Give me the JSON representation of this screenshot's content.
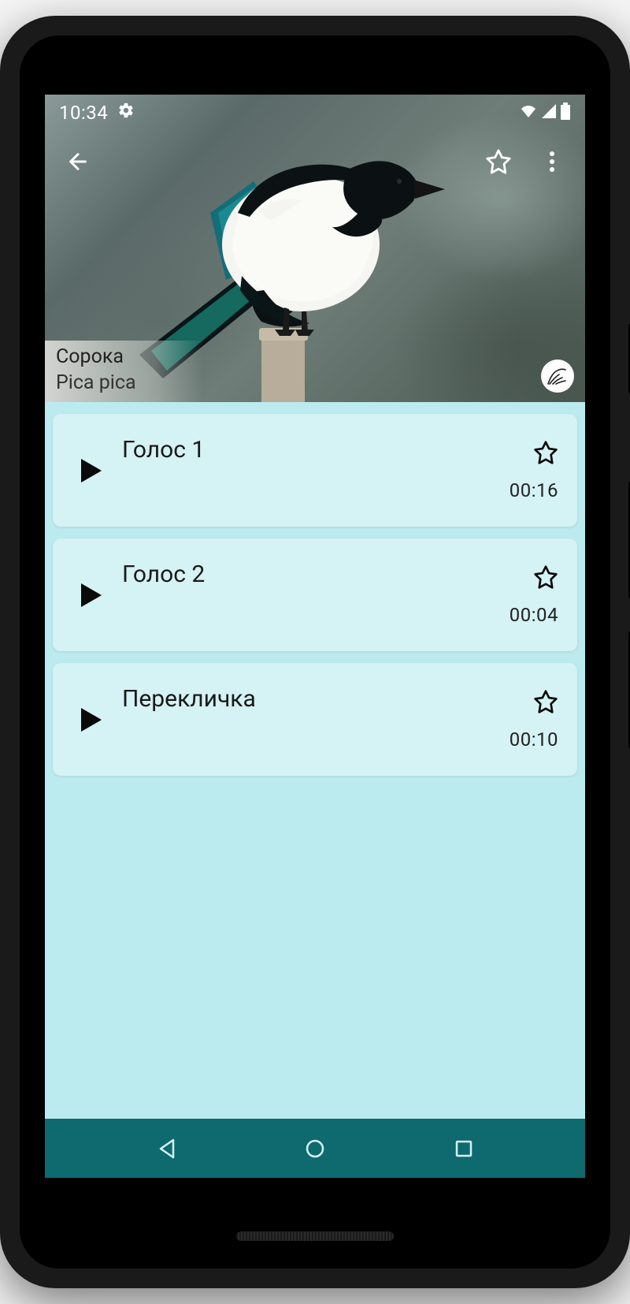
{
  "status": {
    "time": "10:34"
  },
  "bird": {
    "common_name": "Сорока",
    "latin_name": "Pica pica"
  },
  "sounds": [
    {
      "name": "Голос 1",
      "duration": "00:16"
    },
    {
      "name": "Голос 2",
      "duration": "00:04"
    },
    {
      "name": "Перекличка",
      "duration": "00:10"
    }
  ]
}
